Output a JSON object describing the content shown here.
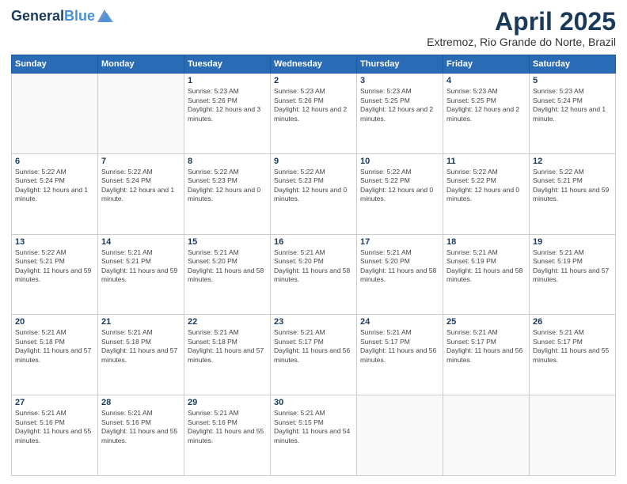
{
  "header": {
    "logo_line1": "General",
    "logo_line2": "Blue",
    "title": "April 2025",
    "subtitle": "Extremoz, Rio Grande do Norte, Brazil"
  },
  "calendar": {
    "headers": [
      "Sunday",
      "Monday",
      "Tuesday",
      "Wednesday",
      "Thursday",
      "Friday",
      "Saturday"
    ],
    "weeks": [
      [
        {
          "day": "",
          "info": ""
        },
        {
          "day": "",
          "info": ""
        },
        {
          "day": "1",
          "info": "Sunrise: 5:23 AM\nSunset: 5:26 PM\nDaylight: 12 hours and 3 minutes."
        },
        {
          "day": "2",
          "info": "Sunrise: 5:23 AM\nSunset: 5:26 PM\nDaylight: 12 hours and 2 minutes."
        },
        {
          "day": "3",
          "info": "Sunrise: 5:23 AM\nSunset: 5:25 PM\nDaylight: 12 hours and 2 minutes."
        },
        {
          "day": "4",
          "info": "Sunrise: 5:23 AM\nSunset: 5:25 PM\nDaylight: 12 hours and 2 minutes."
        },
        {
          "day": "5",
          "info": "Sunrise: 5:23 AM\nSunset: 5:24 PM\nDaylight: 12 hours and 1 minute."
        }
      ],
      [
        {
          "day": "6",
          "info": "Sunrise: 5:22 AM\nSunset: 5:24 PM\nDaylight: 12 hours and 1 minute."
        },
        {
          "day": "7",
          "info": "Sunrise: 5:22 AM\nSunset: 5:24 PM\nDaylight: 12 hours and 1 minute."
        },
        {
          "day": "8",
          "info": "Sunrise: 5:22 AM\nSunset: 5:23 PM\nDaylight: 12 hours and 0 minutes."
        },
        {
          "day": "9",
          "info": "Sunrise: 5:22 AM\nSunset: 5:23 PM\nDaylight: 12 hours and 0 minutes."
        },
        {
          "day": "10",
          "info": "Sunrise: 5:22 AM\nSunset: 5:22 PM\nDaylight: 12 hours and 0 minutes."
        },
        {
          "day": "11",
          "info": "Sunrise: 5:22 AM\nSunset: 5:22 PM\nDaylight: 12 hours and 0 minutes."
        },
        {
          "day": "12",
          "info": "Sunrise: 5:22 AM\nSunset: 5:21 PM\nDaylight: 11 hours and 59 minutes."
        }
      ],
      [
        {
          "day": "13",
          "info": "Sunrise: 5:22 AM\nSunset: 5:21 PM\nDaylight: 11 hours and 59 minutes."
        },
        {
          "day": "14",
          "info": "Sunrise: 5:21 AM\nSunset: 5:21 PM\nDaylight: 11 hours and 59 minutes."
        },
        {
          "day": "15",
          "info": "Sunrise: 5:21 AM\nSunset: 5:20 PM\nDaylight: 11 hours and 58 minutes."
        },
        {
          "day": "16",
          "info": "Sunrise: 5:21 AM\nSunset: 5:20 PM\nDaylight: 11 hours and 58 minutes."
        },
        {
          "day": "17",
          "info": "Sunrise: 5:21 AM\nSunset: 5:20 PM\nDaylight: 11 hours and 58 minutes."
        },
        {
          "day": "18",
          "info": "Sunrise: 5:21 AM\nSunset: 5:19 PM\nDaylight: 11 hours and 58 minutes."
        },
        {
          "day": "19",
          "info": "Sunrise: 5:21 AM\nSunset: 5:19 PM\nDaylight: 11 hours and 57 minutes."
        }
      ],
      [
        {
          "day": "20",
          "info": "Sunrise: 5:21 AM\nSunset: 5:18 PM\nDaylight: 11 hours and 57 minutes."
        },
        {
          "day": "21",
          "info": "Sunrise: 5:21 AM\nSunset: 5:18 PM\nDaylight: 11 hours and 57 minutes."
        },
        {
          "day": "22",
          "info": "Sunrise: 5:21 AM\nSunset: 5:18 PM\nDaylight: 11 hours and 57 minutes."
        },
        {
          "day": "23",
          "info": "Sunrise: 5:21 AM\nSunset: 5:17 PM\nDaylight: 11 hours and 56 minutes."
        },
        {
          "day": "24",
          "info": "Sunrise: 5:21 AM\nSunset: 5:17 PM\nDaylight: 11 hours and 56 minutes."
        },
        {
          "day": "25",
          "info": "Sunrise: 5:21 AM\nSunset: 5:17 PM\nDaylight: 11 hours and 56 minutes."
        },
        {
          "day": "26",
          "info": "Sunrise: 5:21 AM\nSunset: 5:17 PM\nDaylight: 11 hours and 55 minutes."
        }
      ],
      [
        {
          "day": "27",
          "info": "Sunrise: 5:21 AM\nSunset: 5:16 PM\nDaylight: 11 hours and 55 minutes."
        },
        {
          "day": "28",
          "info": "Sunrise: 5:21 AM\nSunset: 5:16 PM\nDaylight: 11 hours and 55 minutes."
        },
        {
          "day": "29",
          "info": "Sunrise: 5:21 AM\nSunset: 5:16 PM\nDaylight: 11 hours and 55 minutes."
        },
        {
          "day": "30",
          "info": "Sunrise: 5:21 AM\nSunset: 5:15 PM\nDaylight: 11 hours and 54 minutes."
        },
        {
          "day": "",
          "info": ""
        },
        {
          "day": "",
          "info": ""
        },
        {
          "day": "",
          "info": ""
        }
      ]
    ]
  }
}
